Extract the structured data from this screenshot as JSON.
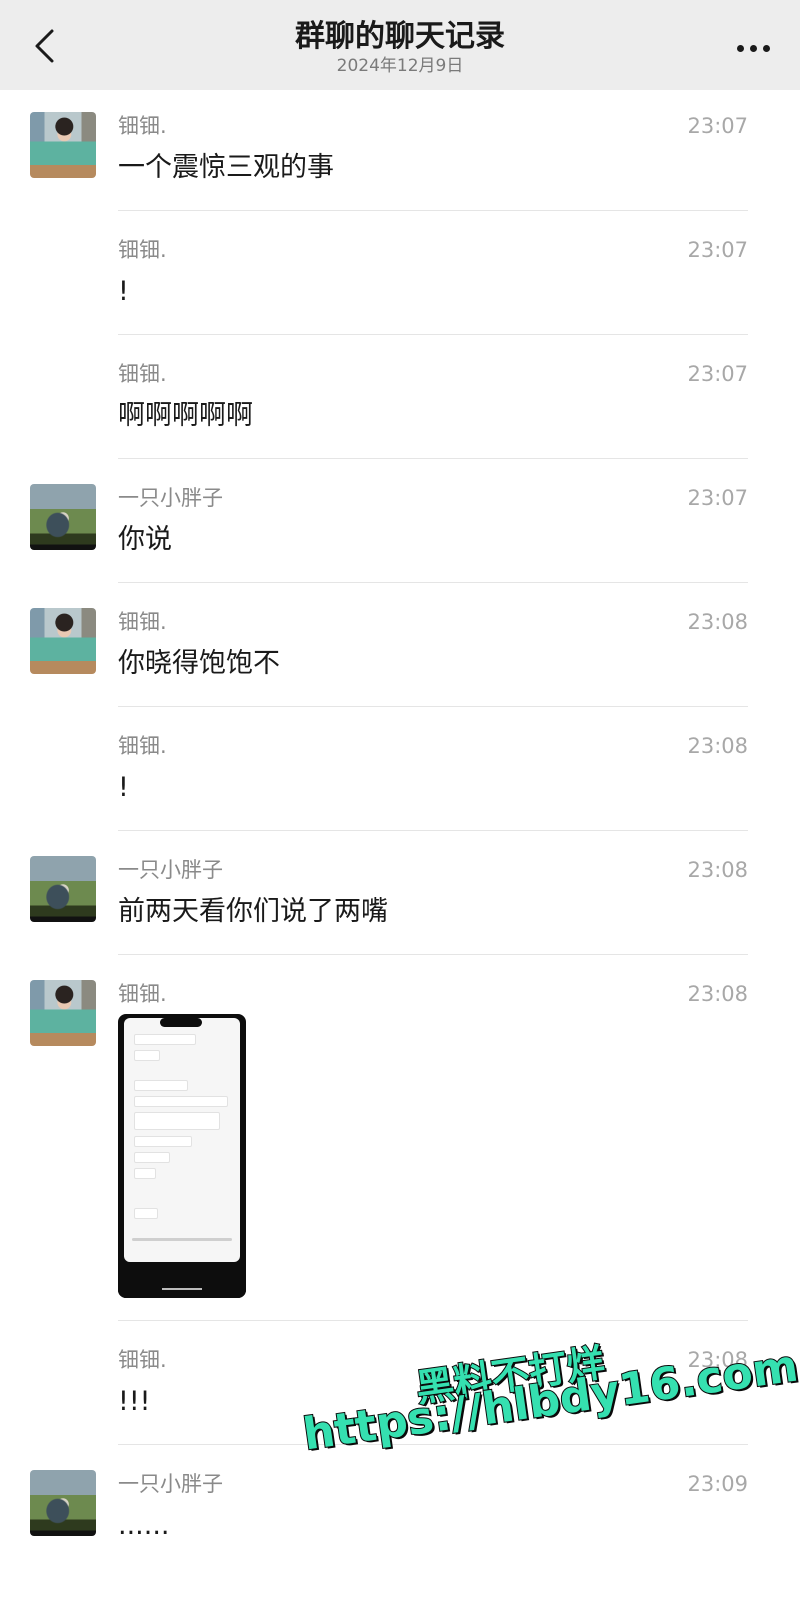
{
  "header": {
    "title": "群聊的聊天记录",
    "date": "2024年12月9日"
  },
  "messages": [
    {
      "sender": "钿钿.",
      "time": "23:07",
      "text": "一个震惊三观的事",
      "avatar": "girl-avatar"
    },
    {
      "sender": "钿钿.",
      "time": "23:07",
      "text": "!"
    },
    {
      "sender": "钿钿.",
      "time": "23:07",
      "text": "啊啊啊啊啊"
    },
    {
      "sender": "一只小胖子",
      "time": "23:07",
      "text": "你说",
      "avatar": "cat-avatar"
    },
    {
      "sender": "钿钿.",
      "time": "23:08",
      "text": "你晓得饱饱不",
      "avatar": "girl-avatar"
    },
    {
      "sender": "钿钿.",
      "time": "23:08",
      "text": "!"
    },
    {
      "sender": "一只小胖子",
      "time": "23:08",
      "text": "前两天看你们说了两嘴",
      "avatar": "cat-avatar"
    },
    {
      "sender": "钿钿.",
      "time": "23:08",
      "type": "image",
      "avatar": "girl-avatar"
    },
    {
      "sender": "钿钿.",
      "time": "23:08",
      "text": "!!!"
    },
    {
      "sender": "一只小胖子",
      "time": "23:09",
      "text": "......",
      "avatar": "cat-avatar"
    }
  ],
  "watermark": {
    "line1": "黑料不打烊",
    "line2": "https://hlbdy16.com",
    "color": "#35e0b0"
  }
}
